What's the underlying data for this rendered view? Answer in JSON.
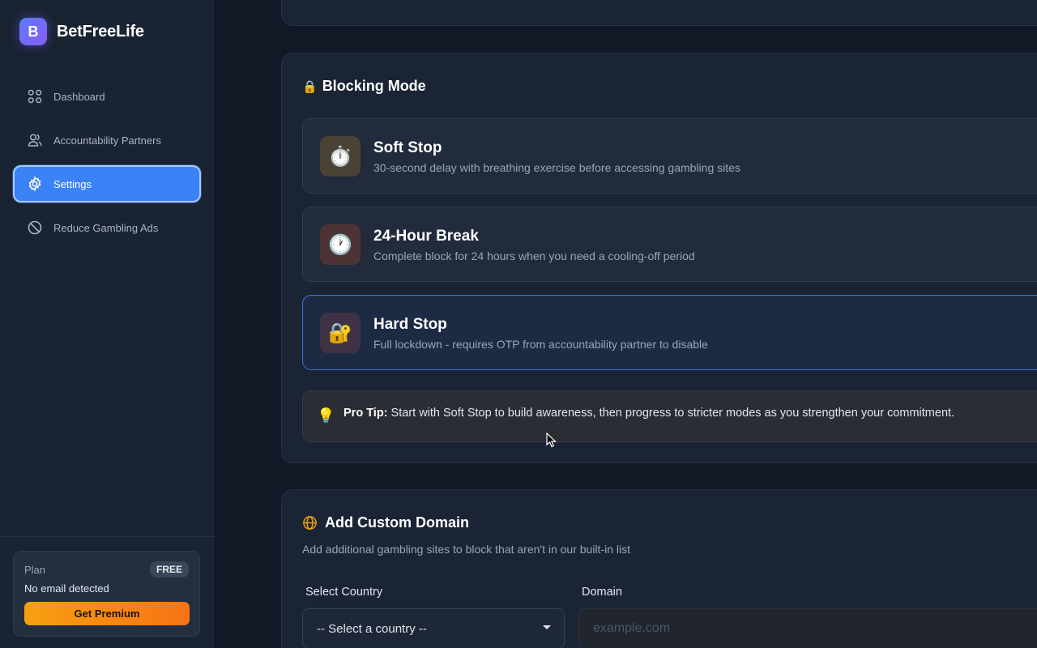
{
  "brand": {
    "logo_letter": "B",
    "name": "BetFreeLife"
  },
  "nav": [
    {
      "label": "Dashboard",
      "icon": "grid-icon"
    },
    {
      "label": "Accountability Partners",
      "icon": "users-icon"
    },
    {
      "label": "Settings",
      "icon": "gear-icon",
      "active": true
    },
    {
      "label": "Reduce Gambling Ads",
      "icon": "block-icon"
    }
  ],
  "plan": {
    "label": "Plan",
    "badge": "FREE",
    "email": "No email detected",
    "cta": "Get Premium"
  },
  "blocking": {
    "title": "Blocking Mode",
    "title_icon": "🔒",
    "modes": [
      {
        "title": "Soft Stop",
        "desc": "30-second delay with breathing exercise before accessing gambling sites",
        "icon": "⏱️",
        "icon_bg": "#4a4234"
      },
      {
        "title": "24-Hour Break",
        "desc": "Complete block for 24 hours when you need a cooling-off period",
        "icon": "🕐",
        "icon_bg": "#4d3434"
      },
      {
        "title": "Hard Stop",
        "desc": "Full lockdown - requires OTP from accountability partner to disable",
        "icon": "🔐",
        "icon_bg": "#3e3244",
        "selected": true
      }
    ],
    "tip": {
      "icon": "💡",
      "label": "Pro Tip:",
      "text": " Start with Soft Stop to build awareness, then progress to stricter modes as you strengthen your commitment."
    }
  },
  "custom_domain": {
    "title": "Add Custom Domain",
    "title_icon": "globe-icon",
    "subtitle": "Add additional gambling sites to block that aren't in our built-in list",
    "country_label": "Select Country",
    "country_value": "-- Select a country --",
    "domain_label": "Domain",
    "domain_placeholder": "example.com"
  },
  "colors": {
    "accent": "#3b82f6",
    "premium": "#f59e0b",
    "globe": "#f5a00f"
  }
}
